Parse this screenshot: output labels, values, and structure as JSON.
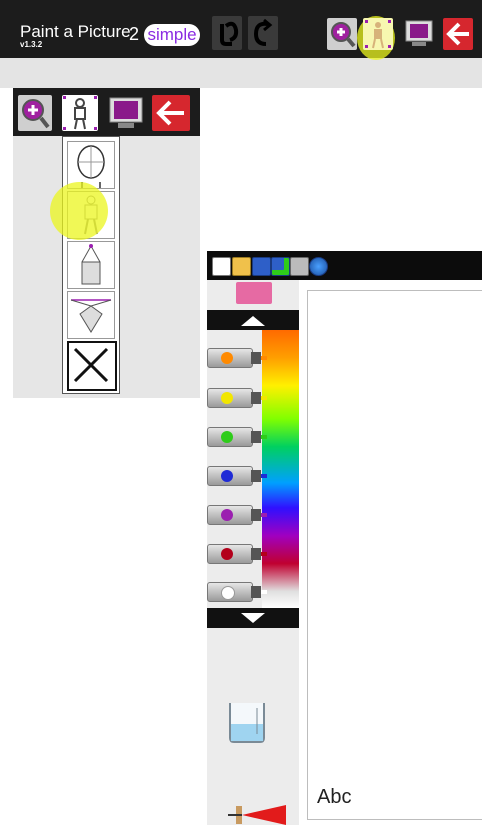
{
  "header": {
    "title": "Paint a Picture",
    "version": "v1.3.2",
    "mode_number": "2",
    "mode_label": "simple",
    "undo_icon": "undo-arrow-icon",
    "redo_icon": "redo-arrow-icon",
    "zoom_icon": "zoom-in-icon",
    "figure_icon": "figure-icon",
    "film_icon": "film-screen-icon",
    "back_icon": "back-arrow-icon"
  },
  "drawing_guides_menu": {
    "items": [
      "face-guide-icon",
      "figure-guide-icon",
      "one-point-perspective-icon",
      "two-point-perspective-icon",
      "close-guides-icon"
    ]
  },
  "file_toolbar": {
    "icons": [
      "new-file-icon",
      "open-folder-icon",
      "save-icon",
      "save-as-icon",
      "print-icon",
      "globe-icon"
    ]
  },
  "palette": {
    "tubes": [
      {
        "name": "orange",
        "color": "#ff8a00"
      },
      {
        "name": "yellow",
        "color": "#f2e600"
      },
      {
        "name": "green",
        "color": "#2ecc1a"
      },
      {
        "name": "blue",
        "color": "#1f2bd6"
      },
      {
        "name": "purple",
        "color": "#9b1fb0"
      },
      {
        "name": "red",
        "color": "#b3001b"
      },
      {
        "name": "white",
        "color": "#ffffff"
      }
    ],
    "eraser_color": "#e66aa3",
    "water_icon": "water-beaker-icon",
    "brush_icon": "brush-icon"
  },
  "canvas": {
    "text_tool_label": "Abc"
  }
}
